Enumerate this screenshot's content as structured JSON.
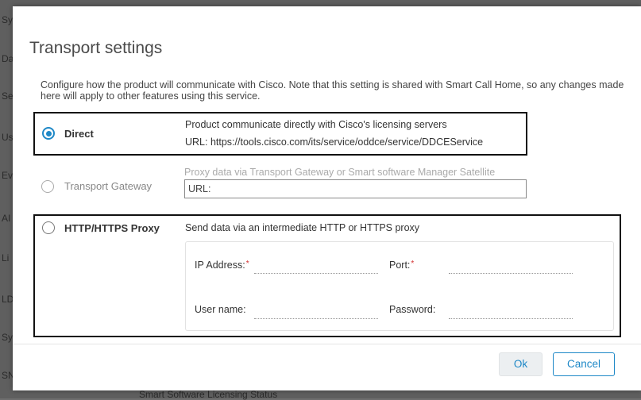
{
  "background": {
    "side_letters": [
      "Sy",
      "Da",
      "Se",
      "Us",
      "Ev",
      "AI",
      "Li",
      "LD",
      "Sy",
      "SN"
    ],
    "bottom_text": "Smart Software Licensing Status"
  },
  "dialog": {
    "title": "Transport settings",
    "description": "Configure how the product will communicate with Cisco. Note that this setting is shared with Smart Call Home, so any changes made here will apply to other features using this service.",
    "options": {
      "direct": {
        "label": "Direct",
        "line1": "Product communicate directly with Cisco's licensing servers",
        "line2": "URL: https://tools.cisco.com/its/service/oddce/service/DDCEService",
        "selected": true
      },
      "gateway": {
        "label": "Transport Gateway",
        "line1": "Proxy data via Transport Gateway or Smart software Manager Satellite",
        "url_placeholder": "URL:",
        "disabled": true
      },
      "proxy": {
        "label": "HTTP/HTTPS Proxy",
        "line1": "Send data via an intermediate HTTP or HTTPS proxy",
        "ip_label": "IP Address:",
        "port_label": "Port:",
        "username_label": "User name:",
        "password_label": "Password:",
        "required_mark": "*",
        "ip_value": "",
        "port_value": "",
        "username_value": "",
        "password_value": ""
      }
    },
    "buttons": {
      "ok": "Ok",
      "cancel": "Cancel"
    }
  },
  "colors": {
    "accent": "#1e88c7",
    "required": "#d32f2f",
    "overlay": "#5f5f5f"
  }
}
